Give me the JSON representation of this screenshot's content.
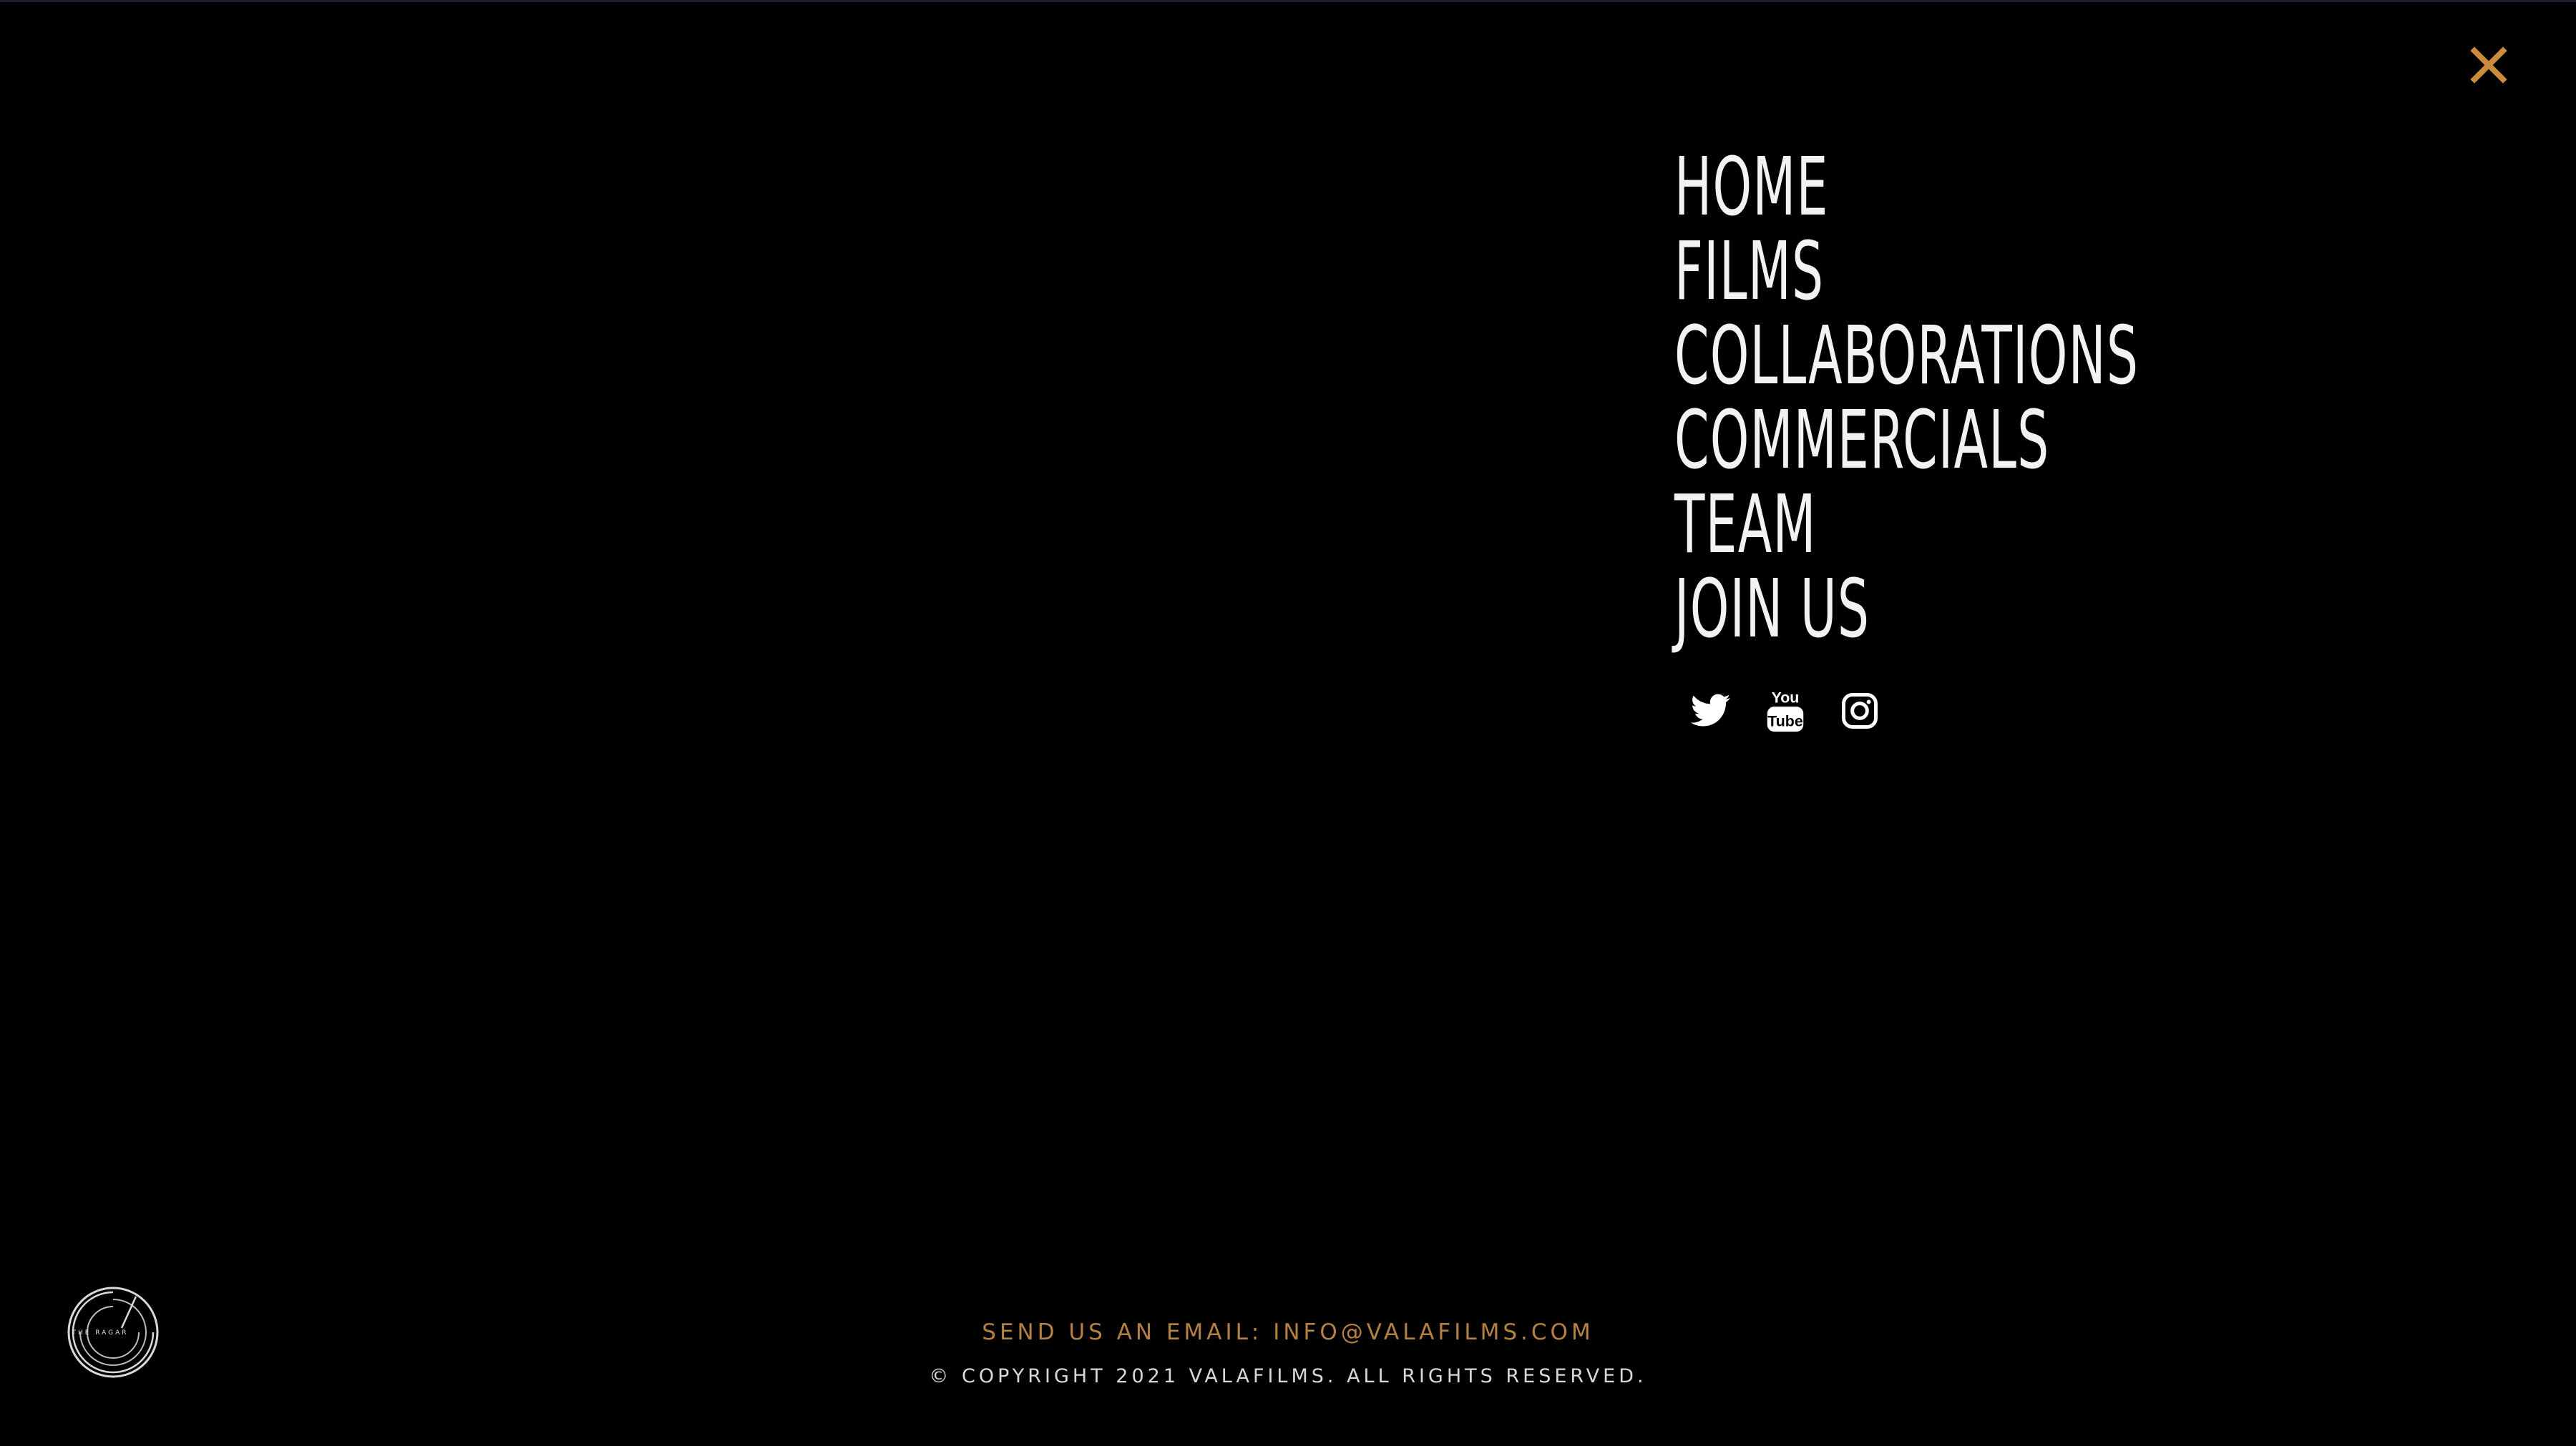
{
  "close": {
    "icon": "close-icon",
    "color": "#c98b3d"
  },
  "menu": {
    "items": [
      {
        "label": "HOME"
      },
      {
        "label": "FILMS"
      },
      {
        "label": "COLLABORATIONS"
      },
      {
        "label": "COMMERCIALS"
      },
      {
        "label": "TEAM"
      },
      {
        "label": "JOIN US"
      }
    ]
  },
  "social": {
    "items": [
      {
        "icon": "twitter-icon"
      },
      {
        "icon": "youtube-icon"
      },
      {
        "icon": "instagram-icon"
      }
    ]
  },
  "logo": {
    "icon": "circular-logo-icon",
    "text": "THE RAGAR"
  },
  "footer": {
    "email_prefix": "SEND US AN EMAIL: ",
    "email": "INFO@VALAFILMS.COM",
    "copyright": "© COPYRIGHT 2021 VALAFILMS. ALL RIGHTS RESERVED."
  },
  "colors": {
    "background": "#000000",
    "accent": "#b58142",
    "menu_text": "#f2f2f2"
  }
}
